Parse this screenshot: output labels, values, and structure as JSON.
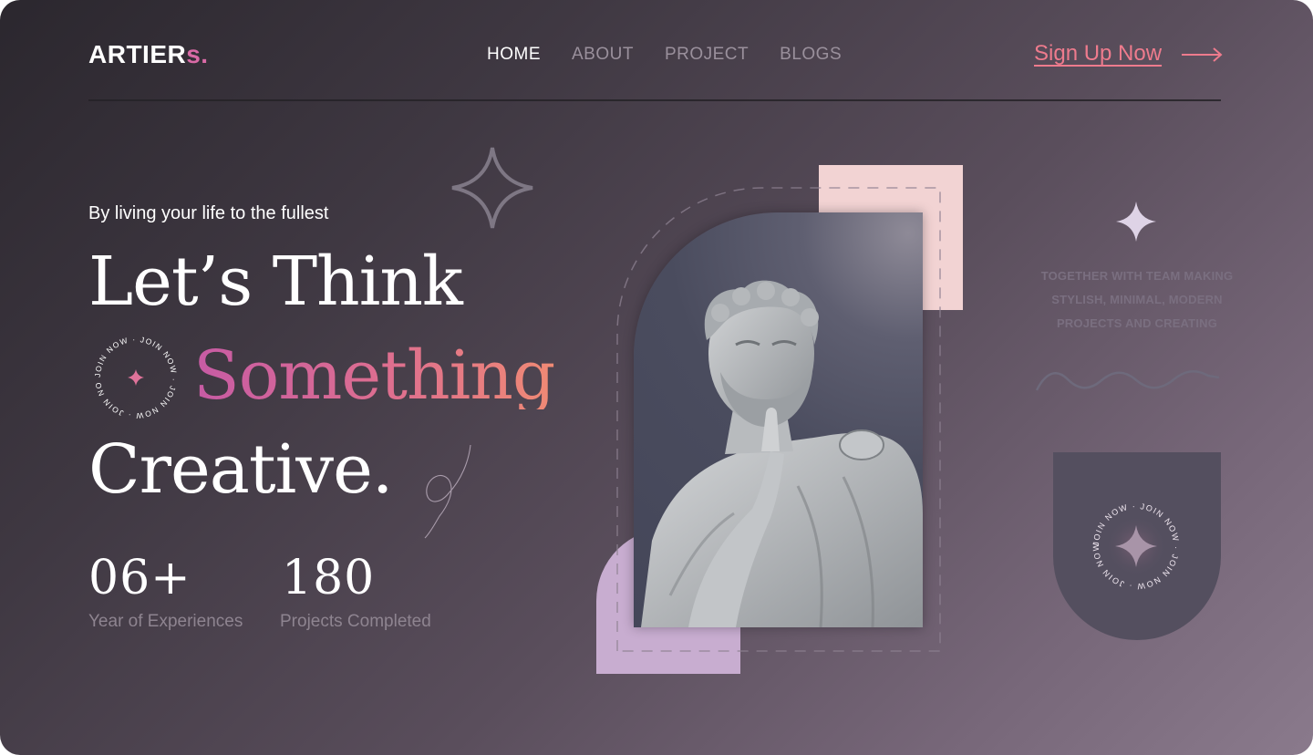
{
  "brand": {
    "name": "ARTIER",
    "accent": "s."
  },
  "nav": {
    "items": [
      {
        "label": "HOME",
        "active": true
      },
      {
        "label": "ABOUT",
        "active": false
      },
      {
        "label": "PROJECT",
        "active": false
      },
      {
        "label": "BLOGS",
        "active": false
      }
    ]
  },
  "cta": {
    "label": "Sign Up Now",
    "icon": "arrow-right-icon"
  },
  "hero": {
    "tagline": "By living your life to the fullest",
    "line1": "Let’s Think",
    "line2": "Something",
    "line3": "Creative.",
    "badge_text": "JOIN NOW · JOIN NOW · JOIN NOW · JOIN NOW ·"
  },
  "stats": [
    {
      "value": "06+",
      "label": "Year of Experiences"
    },
    {
      "value": "180",
      "label": "Projects Completed"
    }
  ],
  "aside": {
    "desc_lines": [
      "TOGETHER WITH TEAM MAKING",
      "STYLISH, MINIMAL, MODERN",
      "PROJECTS AND CREATING"
    ],
    "badge_text": "JOIN NOW · JOIN NOW · JOIN NOW · JOIN NOW ·"
  },
  "colors": {
    "accent_pink": "#ee7b8d",
    "brand_accent": "#d96aa6",
    "block_pink": "#f2d3d3",
    "block_lavender": "#c8add0"
  }
}
